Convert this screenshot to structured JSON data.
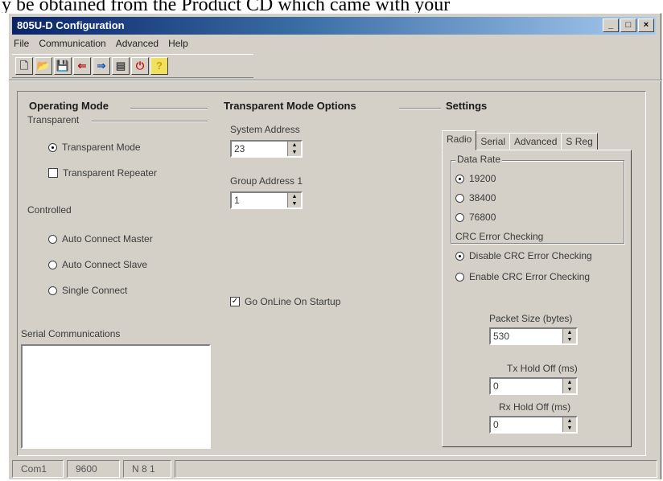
{
  "caption": "y be obtained from the Product CD which came with your",
  "window": {
    "title": "805U-D Configuration",
    "controls": {
      "minimize": "_",
      "maximize": "□",
      "close": "×"
    }
  },
  "menu": [
    "File",
    "Communication",
    "Advanced",
    "Help"
  ],
  "toolbar": {
    "items": [
      {
        "name": "new-icon",
        "glyph": "🗋"
      },
      {
        "name": "open-icon",
        "glyph": "📂"
      },
      {
        "name": "save-icon",
        "glyph": "💾"
      },
      {
        "name": "read-icon",
        "glyph": "⇐"
      },
      {
        "name": "write-icon",
        "glyph": "⇒"
      },
      {
        "name": "print-icon",
        "glyph": "▤"
      },
      {
        "name": "power-icon",
        "glyph": "⏻"
      },
      {
        "name": "help-icon",
        "glyph": "?"
      }
    ]
  },
  "operating": {
    "title": "Operating Mode",
    "transparent_label": "Transparent",
    "transparent_mode": "Transparent Mode",
    "transparent_repeater": "Transparent Repeater",
    "controlled_label": "Controlled",
    "auto_master": "Auto Connect Master",
    "auto_slave": "Auto Connect Slave",
    "single_connect": "Single Connect",
    "serial_comm_label": "Serial Communications"
  },
  "transparent_options": {
    "title": "Transparent Mode Options",
    "system_address_label": "System Address",
    "system_address_value": "23",
    "group_address_label": "Group Address 1",
    "group_address_value": "1",
    "go_online_label": "Go OnLine On Startup"
  },
  "settings": {
    "title": "Settings",
    "tabs": [
      "Radio",
      "Serial",
      "Advanced",
      "S Reg"
    ],
    "data_rate_label": "Data Rate",
    "rates": [
      "19200",
      "38400",
      "76800"
    ],
    "crc_label": "CRC Error Checking",
    "crc_disable": "Disable CRC Error Checking",
    "crc_enable": "Enable CRC Error Checking",
    "packet_size_label": "Packet Size (bytes)",
    "packet_size_value": "530",
    "tx_hold_label": "Tx Hold Off (ms)",
    "tx_hold_value": "0",
    "rx_hold_label": "Rx Hold Off (ms)",
    "rx_hold_value": "0"
  },
  "status": [
    "Com1",
    "9600",
    "N 8 1"
  ]
}
